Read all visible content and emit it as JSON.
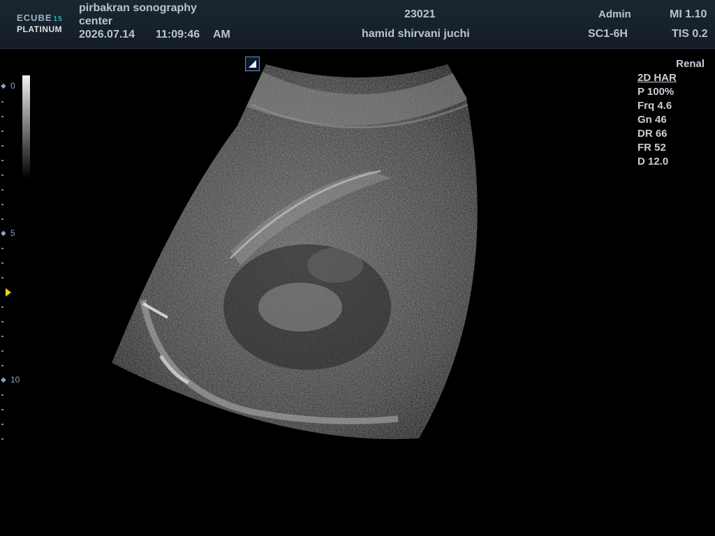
{
  "header": {
    "logo": {
      "brand": "ECUBE",
      "model_number": "15",
      "edition": "PLATINUM"
    },
    "institution_line1": "pirbakran sonography",
    "institution_line2": "center",
    "date": "2026.07.14",
    "time": "11:09:46",
    "ampm": "AM",
    "patient_id": "23021",
    "patient_name": "hamid shirvani juchi",
    "operator": "Admin",
    "probe": "SC1-6H",
    "mi": "MI 1.10",
    "tis": "TIS 0.2"
  },
  "depth_scale": {
    "labels": [
      "0",
      "5",
      "10"
    ],
    "focus_depth_cm": 7.0,
    "max_depth_cm": 12.0
  },
  "imaging_params": {
    "preset": "Renal",
    "mode": "2D HAR",
    "power": "P 100%",
    "frequency": "Frq 4.6",
    "gain": "Gn 46",
    "dynamic_range": "DR 66",
    "frame_rate": "FR 52",
    "depth": "D 12.0"
  },
  "colors": {
    "header_bg": "#1b2632",
    "accent_cyan": "#1fb7c7",
    "scale_blue": "#8aa4c4",
    "focus_marker": "#f4d11a"
  }
}
